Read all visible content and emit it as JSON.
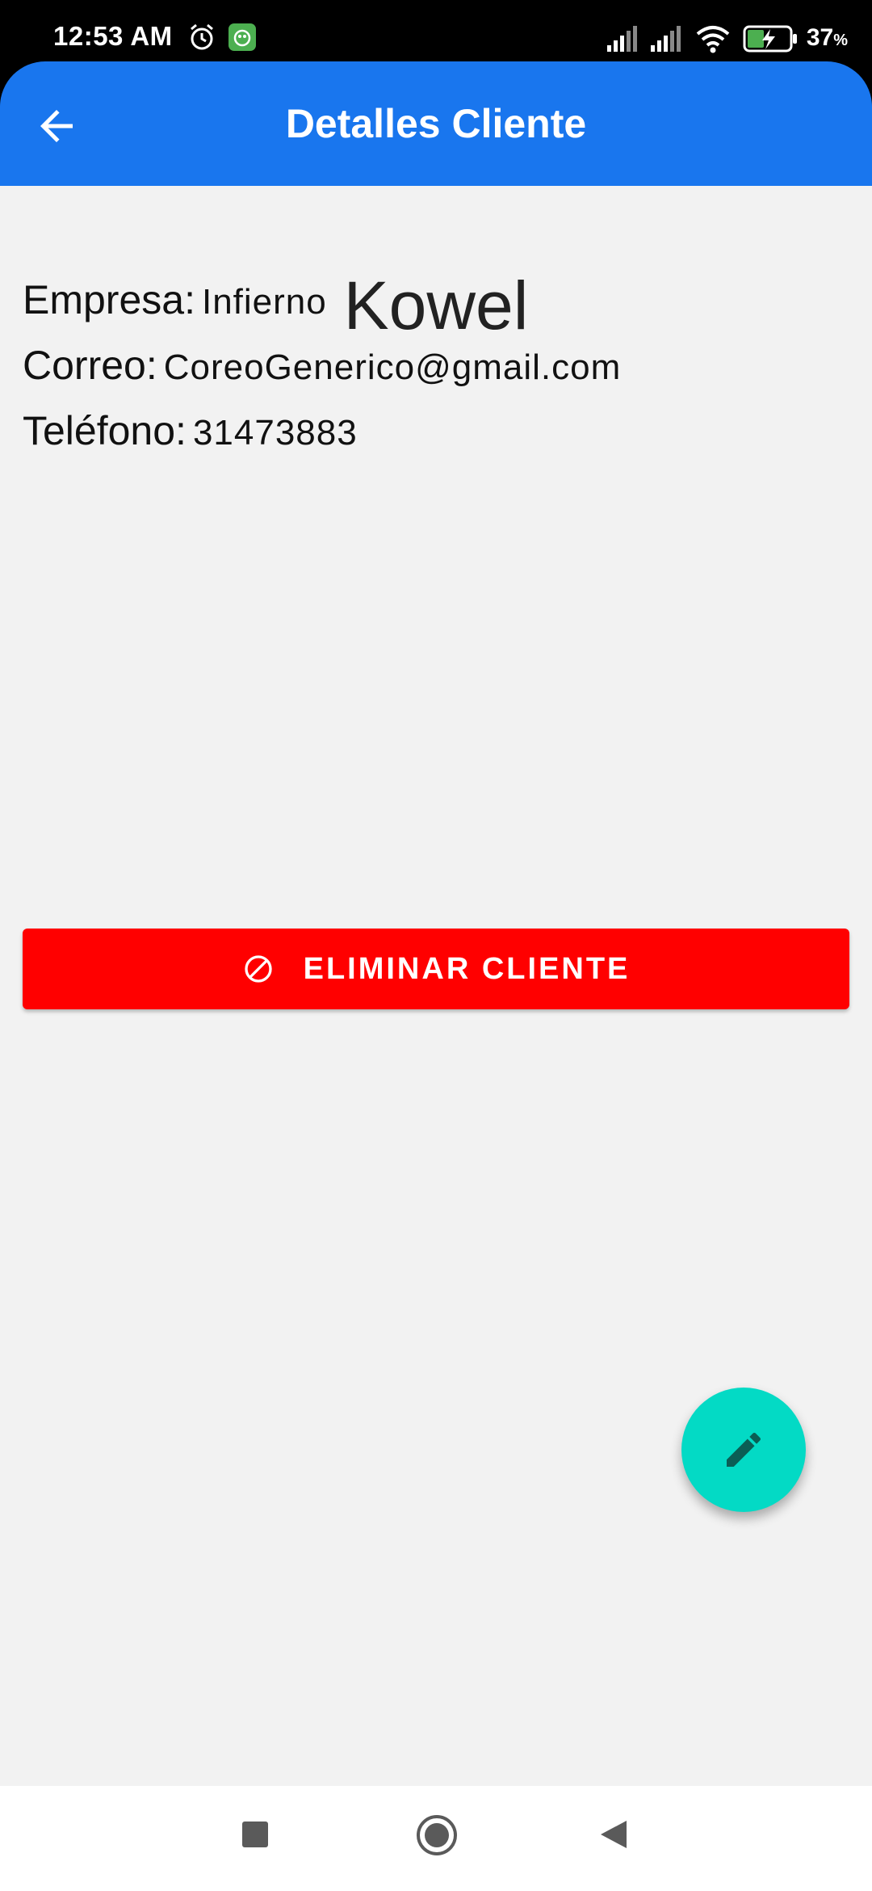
{
  "status_bar": {
    "time": "12:53 AM",
    "battery_percent": "37",
    "battery_suffix": "%",
    "icons": [
      "alarm-icon",
      "app-notification-icon",
      "signal-icon",
      "signal-icon",
      "wifi-icon",
      "battery-charging-icon"
    ]
  },
  "app_bar": {
    "title": "Detalles Cliente",
    "back_icon": "arrow-back-icon",
    "color": "#1976ee"
  },
  "client": {
    "name": "Kowel",
    "fields": [
      {
        "label": "Empresa:",
        "value": "Infierno"
      },
      {
        "label": "Correo:",
        "value": "CoreoGenerico@gmail.com"
      },
      {
        "label": "Teléfono:",
        "value": "31473883"
      }
    ]
  },
  "actions": {
    "delete_label": "ELIMINAR CLIENTE",
    "delete_icon": "block-icon",
    "delete_color": "#ff0000",
    "edit_icon": "pencil-icon",
    "fab_color": "#03dac5"
  },
  "nav_bar": {
    "icons": [
      "recents-square-icon",
      "home-circle-icon",
      "back-triangle-icon"
    ]
  }
}
